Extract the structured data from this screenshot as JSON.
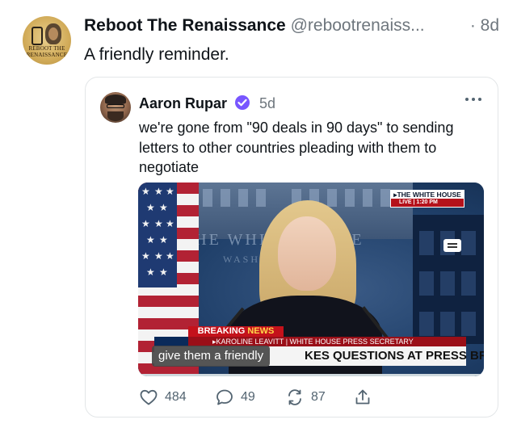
{
  "post": {
    "author": "Reboot The Renaissance",
    "handle": "@rebootrenaiss...",
    "time": "· 8d",
    "text": "A friendly reminder.",
    "avatar_text": "REBOOT THE RENAISSANCE"
  },
  "quote": {
    "author": "Aaron Rupar",
    "verified": true,
    "time": "5d",
    "text": "we're gone from \"90 deals in 90 days\" to sending letters to other countries pleading with them to negotiate",
    "video": {
      "live_top": "▸THE WHITE HOUSE",
      "live_bottom": "LIVE  | 1:20 PM",
      "seal_text": "THE WHITE HOUSE",
      "seal_sub": "WASHINGTON",
      "breaking": "BREAKING",
      "news": "NEWS",
      "lower_third_name": "▸KAROLINE LEAVITT | WHITE HOUSE PRESS SECRETARY",
      "lower_third_headline": "KES QUESTIONS AT PRESS BRIEFING",
      "caption": "give them a friendly",
      "progress": 0.0
    }
  },
  "actions": {
    "replies": "484",
    "reposts": "49",
    "likes_or_quotes": "87"
  },
  "colors": {
    "text_primary": "#0f1419",
    "text_secondary": "#6e767d",
    "verified": "#7856ff",
    "border": "#e3e6e8"
  }
}
